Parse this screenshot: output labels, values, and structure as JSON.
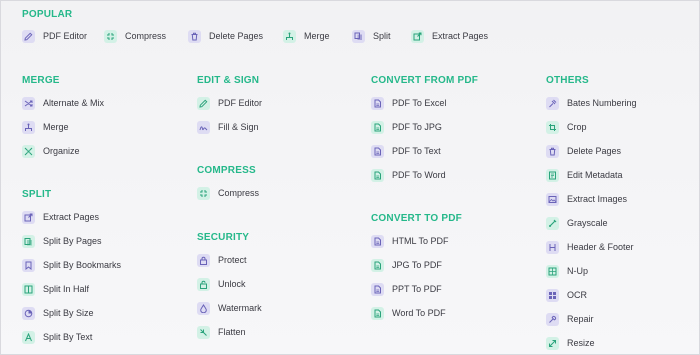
{
  "colors": {
    "accent": "#25b88a",
    "purple_bg": "#dedcf3",
    "purple_fg": "#6a63b8",
    "green_bg": "#d3f1e6",
    "green_fg": "#2aa37b",
    "text": "#3a3a42"
  },
  "popular": {
    "title": "POPULAR",
    "items": [
      {
        "label": "PDF Editor",
        "icon": "pencil-icon",
        "tone": "purple"
      },
      {
        "label": "Compress",
        "icon": "compress-icon",
        "tone": "green"
      },
      {
        "label": "Delete Pages",
        "icon": "trash-icon",
        "tone": "purple"
      },
      {
        "label": "Merge",
        "icon": "merge-icon",
        "tone": "green"
      },
      {
        "label": "Split",
        "icon": "split-icon",
        "tone": "purple"
      },
      {
        "label": "Extract Pages",
        "icon": "extract-icon",
        "tone": "green"
      }
    ]
  },
  "merge": {
    "title": "MERGE",
    "items": [
      {
        "label": "Alternate & Mix",
        "icon": "shuffle-icon",
        "tone": "purple"
      },
      {
        "label": "Merge",
        "icon": "merge-icon",
        "tone": "purple"
      },
      {
        "label": "Organize",
        "icon": "organize-icon",
        "tone": "green"
      }
    ]
  },
  "split": {
    "title": "SPLIT",
    "items": [
      {
        "label": "Extract Pages",
        "icon": "extract-icon",
        "tone": "purple"
      },
      {
        "label": "Split By Pages",
        "icon": "pages-icon",
        "tone": "green"
      },
      {
        "label": "Split By Bookmarks",
        "icon": "bookmark-icon",
        "tone": "purple"
      },
      {
        "label": "Split In Half",
        "icon": "half-icon",
        "tone": "green"
      },
      {
        "label": "Split By Size",
        "icon": "size-icon",
        "tone": "purple"
      },
      {
        "label": "Split By Text",
        "icon": "text-icon",
        "tone": "green"
      }
    ]
  },
  "edit_sign": {
    "title": "EDIT & SIGN",
    "items": [
      {
        "label": "PDF Editor",
        "icon": "pencil-icon",
        "tone": "green"
      },
      {
        "label": "Fill & Sign",
        "icon": "sign-icon",
        "tone": "purple"
      }
    ]
  },
  "compress": {
    "title": "COMPRESS",
    "items": [
      {
        "label": "Compress",
        "icon": "compress-icon",
        "tone": "green"
      }
    ]
  },
  "security": {
    "title": "SECURITY",
    "items": [
      {
        "label": "Protect",
        "icon": "lock-icon",
        "tone": "purple"
      },
      {
        "label": "Unlock",
        "icon": "unlock-icon",
        "tone": "green"
      },
      {
        "label": "Watermark",
        "icon": "watermark-icon",
        "tone": "purple"
      },
      {
        "label": "Flatten",
        "icon": "flatten-icon",
        "tone": "green"
      }
    ]
  },
  "convert_from": {
    "title": "CONVERT FROM PDF",
    "items": [
      {
        "label": "PDF To Excel",
        "icon": "document-icon",
        "tone": "purple"
      },
      {
        "label": "PDF To JPG",
        "icon": "document-icon",
        "tone": "green"
      },
      {
        "label": "PDF To Text",
        "icon": "document-icon",
        "tone": "purple"
      },
      {
        "label": "PDF To Word",
        "icon": "document-icon",
        "tone": "green"
      }
    ]
  },
  "convert_to": {
    "title": "CONVERT TO PDF",
    "items": [
      {
        "label": "HTML To PDF",
        "icon": "document-icon",
        "tone": "purple"
      },
      {
        "label": "JPG To PDF",
        "icon": "document-icon",
        "tone": "green"
      },
      {
        "label": "PPT To PDF",
        "icon": "document-icon",
        "tone": "purple"
      },
      {
        "label": "Word To PDF",
        "icon": "document-icon",
        "tone": "green"
      }
    ]
  },
  "others": {
    "title": "OTHERS",
    "items": [
      {
        "label": "Bates Numbering",
        "icon": "numbering-icon",
        "tone": "purple"
      },
      {
        "label": "Crop",
        "icon": "crop-icon",
        "tone": "green"
      },
      {
        "label": "Delete Pages",
        "icon": "trash-icon",
        "tone": "purple"
      },
      {
        "label": "Edit Metadata",
        "icon": "metadata-icon",
        "tone": "green"
      },
      {
        "label": "Extract Images",
        "icon": "image-icon",
        "tone": "purple"
      },
      {
        "label": "Grayscale",
        "icon": "grayscale-icon",
        "tone": "green"
      },
      {
        "label": "Header & Footer",
        "icon": "header-icon",
        "tone": "purple"
      },
      {
        "label": "N-Up",
        "icon": "grid-icon",
        "tone": "green"
      },
      {
        "label": "OCR",
        "icon": "ocr-icon",
        "tone": "purple"
      },
      {
        "label": "Repair",
        "icon": "repair-icon",
        "tone": "purple"
      },
      {
        "label": "Resize",
        "icon": "resize-icon",
        "tone": "green"
      }
    ]
  }
}
